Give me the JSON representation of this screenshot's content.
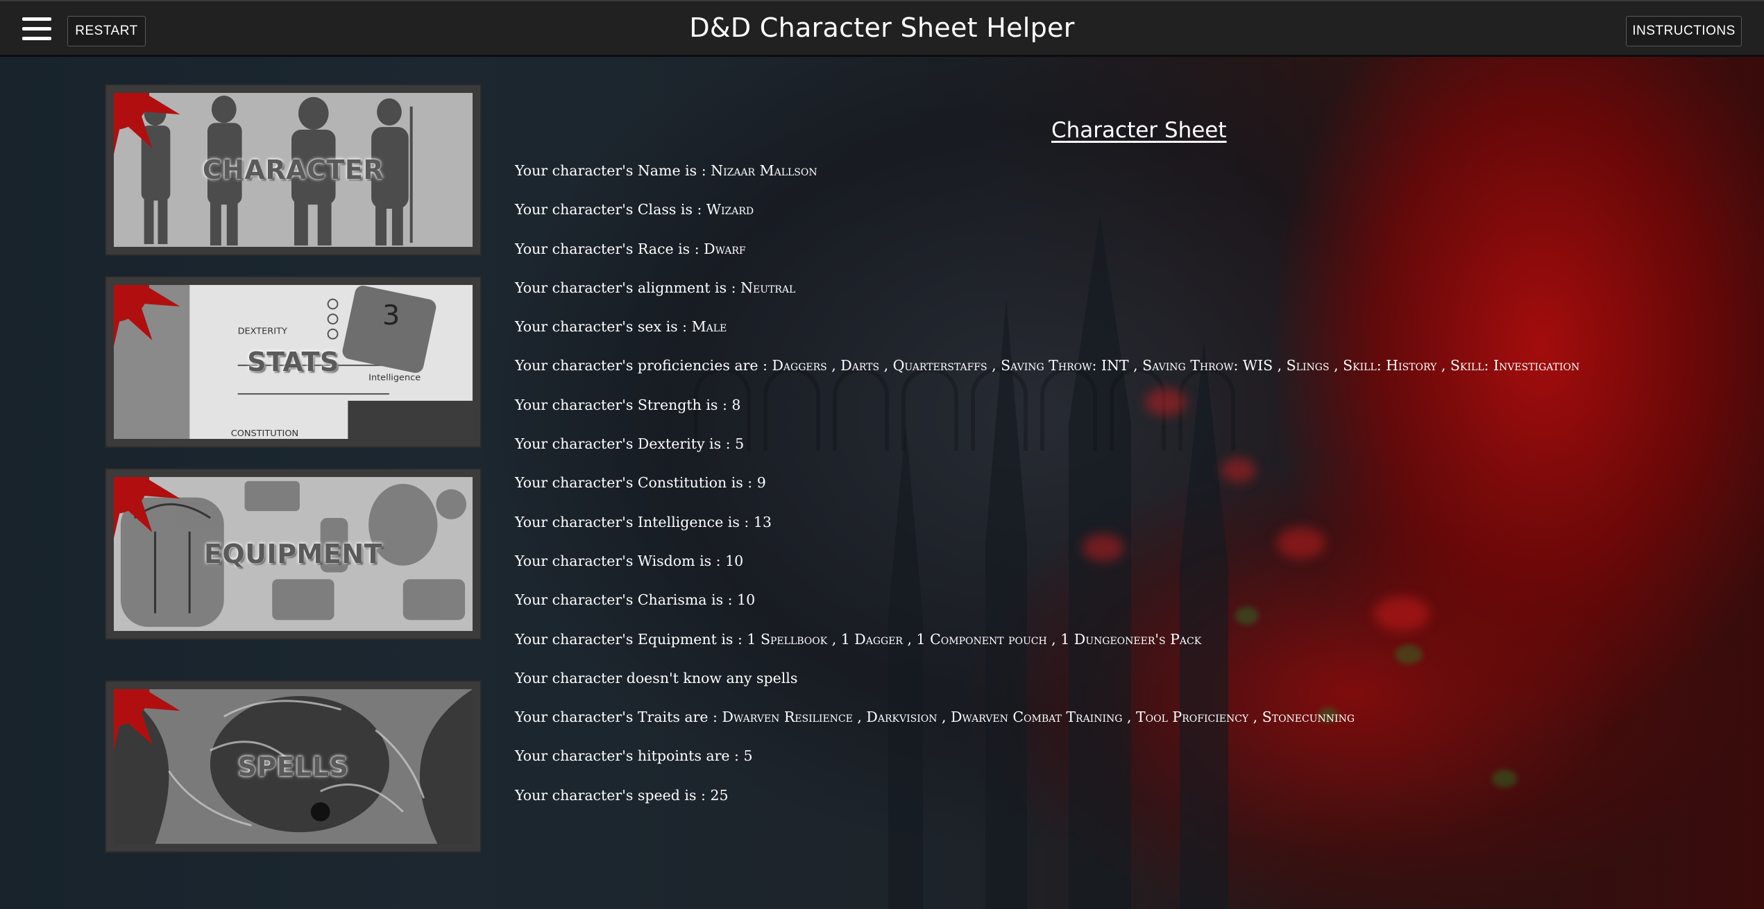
{
  "header": {
    "menu_icon": "hamburger-menu-icon",
    "restart_label": "RESTART",
    "title": "D&D Character Sheet Helper",
    "instructions_label": "INSTRUCTIONS"
  },
  "nav_cards": [
    {
      "label": "CHARACTER",
      "icon": "character-card-image"
    },
    {
      "label": "STATS",
      "icon": "stats-card-image"
    },
    {
      "label": "EQUIPMENT",
      "icon": "equipment-card-image"
    },
    {
      "label": "SPELLS",
      "icon": "spells-card-image"
    }
  ],
  "colors": {
    "splat": "#b10f0f",
    "topbar": "#212121",
    "card_frame": "#3b3b3b"
  },
  "sheet": {
    "title": "Character Sheet",
    "lines": [
      {
        "prefix": "Your character's Name is : ",
        "value": "Nizaar Mallson"
      },
      {
        "prefix": "Your character's Class is : ",
        "value": "Wizard"
      },
      {
        "prefix": "Your character's Race is : ",
        "value": "Dwarf"
      },
      {
        "prefix": "Your character's alignment is : ",
        "value": "Neutral"
      },
      {
        "prefix": "Your character's sex is : ",
        "value": "Male"
      },
      {
        "prefix": "Your character's proficiencies are : ",
        "value": "Daggers , Darts , Quarterstaffs , Saving Throw: INT , Saving Throw: WIS , Slings , Skill: History , Skill: Investigation"
      },
      {
        "prefix": "Your character's Strength is : ",
        "value": "8"
      },
      {
        "prefix": "Your character's Dexterity is : ",
        "value": "5"
      },
      {
        "prefix": "Your character's Constitution is : ",
        "value": "9"
      },
      {
        "prefix": "Your character's Intelligence is : ",
        "value": "13"
      },
      {
        "prefix": "Your character's Wisdom is : ",
        "value": "10"
      },
      {
        "prefix": "Your character's Charisma is : ",
        "value": "10"
      },
      {
        "prefix": "Your character's Equipment is : ",
        "value": "1 Spellbook , 1 Dagger , 1 Component pouch , 1 Dungeoneer's Pack"
      },
      {
        "prefix": "Your character doesn't know any spells",
        "value": ""
      },
      {
        "prefix": "Your character's Traits are : ",
        "value": "Dwarven Resilience , Darkvision , Dwarven Combat Training , Tool Proficiency , Stonecunning"
      },
      {
        "prefix": "Your character's hitpoints are : ",
        "value": "5"
      },
      {
        "prefix": "Your character's speed is : ",
        "value": "25"
      }
    ]
  }
}
